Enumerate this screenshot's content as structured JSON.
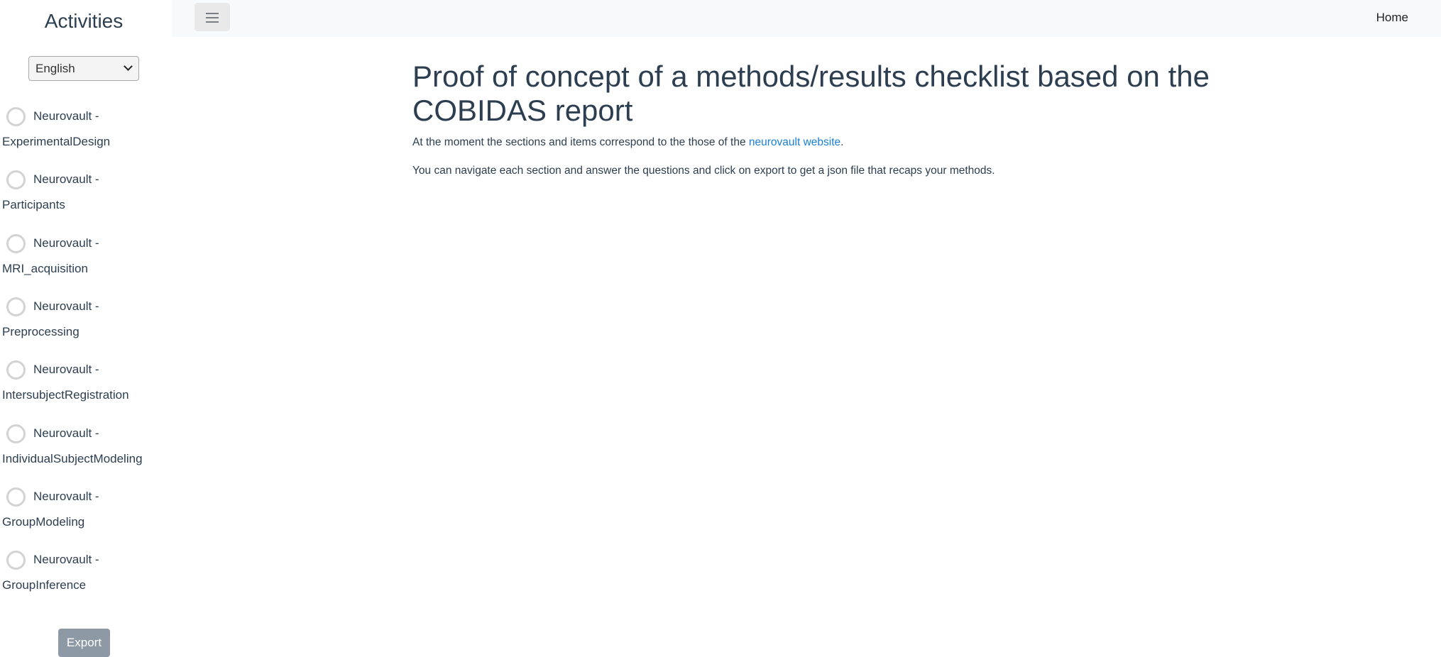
{
  "sidebar": {
    "title": "Activities",
    "language": {
      "selected": "English"
    },
    "activities": [
      {
        "line1": "Neurovault -",
        "line2": "ExperimentalDesign"
      },
      {
        "line1": "Neurovault -",
        "line2": "Participants"
      },
      {
        "line1": "Neurovault -",
        "line2": "MRI_acquisition"
      },
      {
        "line1": "Neurovault -",
        "line2": "Preprocessing"
      },
      {
        "line1": "Neurovault -",
        "line2": "IntersubjectRegistration"
      },
      {
        "line1": "Neurovault -",
        "line2": "IndividualSubjectModeling"
      },
      {
        "line1": "Neurovault -",
        "line2": "GroupModeling"
      },
      {
        "line1": "Neurovault -",
        "line2": "GroupInference"
      }
    ],
    "export_label": "Export"
  },
  "topbar": {
    "menu_icon": "hamburger-menu-icon",
    "home_label": "Home"
  },
  "main": {
    "title": "Proof of concept of a methods/results checklist based on the COBIDAS report",
    "para1_before": "At the moment the sections and items correspond to the those of the ",
    "para1_link": "neurovault website",
    "para1_after": ".",
    "para2": "You can navigate each section and answer the questions and click on export to get a json file that recaps your methods."
  },
  "colors": {
    "text": "#2c3e50",
    "link": "#1a7fd6",
    "topbar_bg": "#f8f9fa",
    "export_button_bg": "#8d9aa6"
  }
}
